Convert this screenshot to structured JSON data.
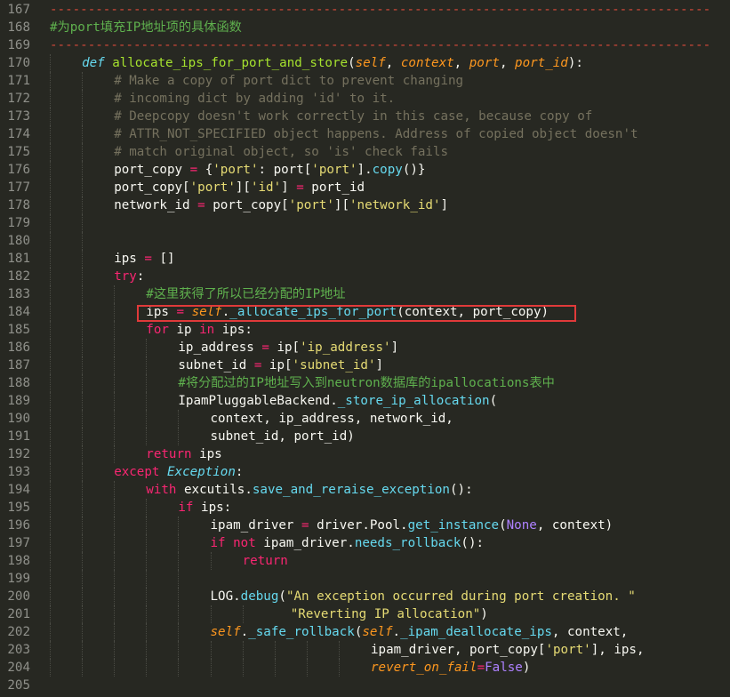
{
  "editor": {
    "lines": [
      {
        "n": "167",
        "indent": 0,
        "segs": [
          {
            "t": "---------------------------------------------------------------------------------------",
            "c": "sep"
          }
        ]
      },
      {
        "n": "168",
        "indent": 0,
        "segs": [
          {
            "t": "#为port填充IP地址项的具体函数",
            "c": "cz"
          }
        ]
      },
      {
        "n": "169",
        "indent": 0,
        "segs": [
          {
            "t": "---------------------------------------------------------------------------------------",
            "c": "sep"
          }
        ]
      },
      {
        "n": "170",
        "indent": 1,
        "segs": [
          {
            "t": "def",
            "c": "d"
          },
          {
            "t": " ",
            "c": ""
          },
          {
            "t": "allocate_ips_for_port_and_store",
            "c": "f"
          },
          {
            "t": "(",
            "c": ""
          },
          {
            "t": "self",
            "c": "p"
          },
          {
            "t": ", ",
            "c": ""
          },
          {
            "t": "context",
            "c": "p"
          },
          {
            "t": ", ",
            "c": ""
          },
          {
            "t": "port",
            "c": "p"
          },
          {
            "t": ", ",
            "c": ""
          },
          {
            "t": "port_id",
            "c": "p"
          },
          {
            "t": "):",
            "c": ""
          }
        ]
      },
      {
        "n": "171",
        "indent": 2,
        "segs": [
          {
            "t": "# Make a copy of port dict to prevent changing",
            "c": "c"
          }
        ]
      },
      {
        "n": "172",
        "indent": 2,
        "segs": [
          {
            "t": "# incoming dict by adding 'id' to it.",
            "c": "c"
          }
        ]
      },
      {
        "n": "173",
        "indent": 2,
        "segs": [
          {
            "t": "# Deepcopy doesn't work correctly in this case, because copy of",
            "c": "c"
          }
        ]
      },
      {
        "n": "174",
        "indent": 2,
        "segs": [
          {
            "t": "# ATTR_NOT_SPECIFIED object happens. Address of copied object doesn't",
            "c": "c"
          }
        ]
      },
      {
        "n": "175",
        "indent": 2,
        "segs": [
          {
            "t": "# match original object, so 'is' check fails",
            "c": "c"
          }
        ]
      },
      {
        "n": "176",
        "indent": 2,
        "segs": [
          {
            "t": "port_copy ",
            "c": ""
          },
          {
            "t": "=",
            "c": "k"
          },
          {
            "t": " {",
            "c": ""
          },
          {
            "t": "'port'",
            "c": "s"
          },
          {
            "t": ": port[",
            "c": ""
          },
          {
            "t": "'port'",
            "c": "s"
          },
          {
            "t": "].",
            "c": ""
          },
          {
            "t": "copy",
            "c": "b"
          },
          {
            "t": "()}",
            "c": ""
          }
        ]
      },
      {
        "n": "177",
        "indent": 2,
        "segs": [
          {
            "t": "port_copy[",
            "c": ""
          },
          {
            "t": "'port'",
            "c": "s"
          },
          {
            "t": "][",
            "c": ""
          },
          {
            "t": "'id'",
            "c": "s"
          },
          {
            "t": "] ",
            "c": ""
          },
          {
            "t": "=",
            "c": "k"
          },
          {
            "t": " port_id",
            "c": ""
          }
        ]
      },
      {
        "n": "178",
        "indent": 2,
        "segs": [
          {
            "t": "network_id ",
            "c": ""
          },
          {
            "t": "=",
            "c": "k"
          },
          {
            "t": " port_copy[",
            "c": ""
          },
          {
            "t": "'port'",
            "c": "s"
          },
          {
            "t": "][",
            "c": ""
          },
          {
            "t": "'network_id'",
            "c": "s"
          },
          {
            "t": "]",
            "c": ""
          }
        ]
      },
      {
        "n": "179",
        "indent": 2,
        "segs": []
      },
      {
        "n": "180",
        "indent": 2,
        "segs": []
      },
      {
        "n": "181",
        "indent": 2,
        "segs": [
          {
            "t": "ips ",
            "c": ""
          },
          {
            "t": "=",
            "c": "k"
          },
          {
            "t": " []",
            "c": ""
          }
        ]
      },
      {
        "n": "182",
        "indent": 2,
        "segs": [
          {
            "t": "try",
            "c": "k"
          },
          {
            "t": ":",
            "c": ""
          }
        ]
      },
      {
        "n": "183",
        "indent": 3,
        "segs": [
          {
            "t": "#这里获得了所以已经分配的IP地址",
            "c": "cz"
          }
        ]
      },
      {
        "n": "184",
        "indent": 3,
        "segs": [
          {
            "t": "ips ",
            "c": ""
          },
          {
            "t": "=",
            "c": "k"
          },
          {
            "t": " ",
            "c": ""
          },
          {
            "t": "self",
            "c": "p"
          },
          {
            "t": ".",
            "c": ""
          },
          {
            "t": "_allocate_ips_for_port",
            "c": "b"
          },
          {
            "t": "(context, port_copy)",
            "c": ""
          }
        ]
      },
      {
        "n": "185",
        "indent": 3,
        "segs": [
          {
            "t": "for",
            "c": "k"
          },
          {
            "t": " ip ",
            "c": ""
          },
          {
            "t": "in",
            "c": "k"
          },
          {
            "t": " ips:",
            "c": ""
          }
        ]
      },
      {
        "n": "186",
        "indent": 4,
        "segs": [
          {
            "t": "ip_address ",
            "c": ""
          },
          {
            "t": "=",
            "c": "k"
          },
          {
            "t": " ip[",
            "c": ""
          },
          {
            "t": "'ip_address'",
            "c": "s"
          },
          {
            "t": "]",
            "c": ""
          }
        ]
      },
      {
        "n": "187",
        "indent": 4,
        "segs": [
          {
            "t": "subnet_id ",
            "c": ""
          },
          {
            "t": "=",
            "c": "k"
          },
          {
            "t": " ip[",
            "c": ""
          },
          {
            "t": "'subnet_id'",
            "c": "s"
          },
          {
            "t": "]",
            "c": ""
          }
        ]
      },
      {
        "n": "188",
        "indent": 4,
        "segs": [
          {
            "t": "#将分配过的IP地址写入到neutron数据库的ipallocations表中",
            "c": "cz"
          }
        ]
      },
      {
        "n": "189",
        "indent": 4,
        "segs": [
          {
            "t": "IpamPluggableBackend.",
            "c": ""
          },
          {
            "t": "_store_ip_allocation",
            "c": "b"
          },
          {
            "t": "(",
            "c": ""
          }
        ]
      },
      {
        "n": "190",
        "indent": 5,
        "segs": [
          {
            "t": "context, ip_address, network_id,",
            "c": ""
          }
        ]
      },
      {
        "n": "191",
        "indent": 5,
        "segs": [
          {
            "t": "subnet_id, port_id)",
            "c": ""
          }
        ]
      },
      {
        "n": "192",
        "indent": 3,
        "segs": [
          {
            "t": "return",
            "c": "k"
          },
          {
            "t": " ips",
            "c": ""
          }
        ]
      },
      {
        "n": "193",
        "indent": 2,
        "segs": [
          {
            "t": "except",
            "c": "k"
          },
          {
            "t": " ",
            "c": ""
          },
          {
            "t": "Exception",
            "c": "d"
          },
          {
            "t": ":",
            "c": ""
          }
        ]
      },
      {
        "n": "194",
        "indent": 3,
        "segs": [
          {
            "t": "with",
            "c": "k"
          },
          {
            "t": " excutils.",
            "c": ""
          },
          {
            "t": "save_and_reraise_exception",
            "c": "b"
          },
          {
            "t": "():",
            "c": ""
          }
        ]
      },
      {
        "n": "195",
        "indent": 4,
        "segs": [
          {
            "t": "if",
            "c": "k"
          },
          {
            "t": " ips:",
            "c": ""
          }
        ]
      },
      {
        "n": "196",
        "indent": 5,
        "segs": [
          {
            "t": "ipam_driver ",
            "c": ""
          },
          {
            "t": "=",
            "c": "k"
          },
          {
            "t": " driver.Pool.",
            "c": ""
          },
          {
            "t": "get_instance",
            "c": "b"
          },
          {
            "t": "(",
            "c": ""
          },
          {
            "t": "None",
            "c": "cn"
          },
          {
            "t": ", context)",
            "c": ""
          }
        ]
      },
      {
        "n": "197",
        "indent": 5,
        "segs": [
          {
            "t": "if",
            "c": "k"
          },
          {
            "t": " ",
            "c": ""
          },
          {
            "t": "not",
            "c": "k"
          },
          {
            "t": " ipam_driver.",
            "c": ""
          },
          {
            "t": "needs_rollback",
            "c": "b"
          },
          {
            "t": "():",
            "c": ""
          }
        ]
      },
      {
        "n": "198",
        "indent": 6,
        "segs": [
          {
            "t": "return",
            "c": "k"
          }
        ]
      },
      {
        "n": "199",
        "indent": 5,
        "segs": []
      },
      {
        "n": "200",
        "indent": 5,
        "segs": [
          {
            "t": "LOG.",
            "c": ""
          },
          {
            "t": "debug",
            "c": "b"
          },
          {
            "t": "(",
            "c": ""
          },
          {
            "t": "\"An exception occurred during port creation. \"",
            "c": "s"
          }
        ]
      },
      {
        "n": "201",
        "indent": 7.5,
        "segs": [
          {
            "t": "\"Reverting IP allocation\"",
            "c": "s"
          },
          {
            "t": ")",
            "c": ""
          }
        ]
      },
      {
        "n": "202",
        "indent": 5,
        "segs": [
          {
            "t": "self",
            "c": "p"
          },
          {
            "t": ".",
            "c": ""
          },
          {
            "t": "_safe_rollback",
            "c": "b"
          },
          {
            "t": "(",
            "c": ""
          },
          {
            "t": "self",
            "c": "p"
          },
          {
            "t": ".",
            "c": ""
          },
          {
            "t": "_ipam_deallocate_ips",
            "c": "b"
          },
          {
            "t": ", context,",
            "c": ""
          }
        ]
      },
      {
        "n": "203",
        "indent": 10,
        "segs": [
          {
            "t": "ipam_driver, port_copy[",
            "c": ""
          },
          {
            "t": "'port'",
            "c": "s"
          },
          {
            "t": "], ips,",
            "c": ""
          }
        ]
      },
      {
        "n": "204",
        "indent": 10,
        "segs": [
          {
            "t": "revert_on_fail",
            "c": "p"
          },
          {
            "t": "=",
            "c": "k"
          },
          {
            "t": "False",
            "c": "cn"
          },
          {
            "t": ")",
            "c": ""
          }
        ]
      },
      {
        "n": "205",
        "indent": 0,
        "segs": []
      }
    ]
  }
}
